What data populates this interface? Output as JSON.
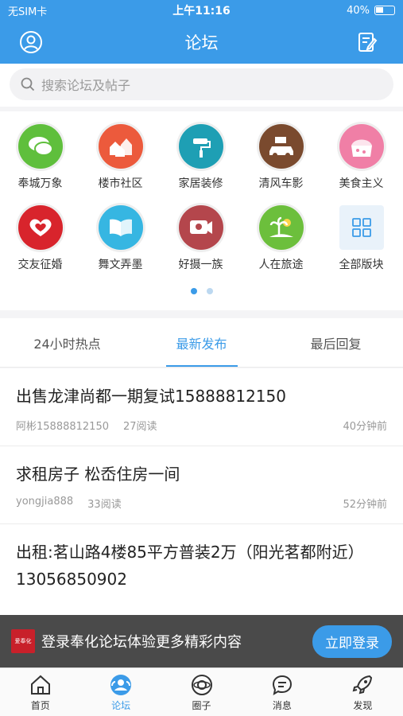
{
  "status": {
    "carrier": "无SIM卡",
    "time": "上午11:16",
    "battery": "40%"
  },
  "header": {
    "title": "论坛"
  },
  "search": {
    "placeholder": "搜索论坛及帖子"
  },
  "categories": [
    {
      "label": "奉城万象",
      "icon": "chat-bubbles-icon",
      "color": "#5fbf3c"
    },
    {
      "label": "楼市社区",
      "icon": "houses-icon",
      "color": "#ec5a3c"
    },
    {
      "label": "家居装修",
      "icon": "paint-roller-icon",
      "color": "#1e9fb4"
    },
    {
      "label": "清风车影",
      "icon": "car-icon",
      "color": "#7a4a2e"
    },
    {
      "label": "美食主义",
      "icon": "cake-icon",
      "color": "#f07fa6"
    },
    {
      "label": "交友征婚",
      "icon": "hearts-icon",
      "color": "#d8242c"
    },
    {
      "label": "舞文弄墨",
      "icon": "book-icon",
      "color": "#36b6e2"
    },
    {
      "label": "好摄一族",
      "icon": "camera-icon",
      "color": "#b4464c"
    },
    {
      "label": "人在旅途",
      "icon": "palm-tree-icon",
      "color": "#6cbf3c"
    },
    {
      "label": "全部版块",
      "icon": "grid-icon",
      "color": "#e9f2fa"
    }
  ],
  "tabs": [
    {
      "label": "24小时热点"
    },
    {
      "label": "最新发布"
    },
    {
      "label": "最后回复"
    }
  ],
  "posts": [
    {
      "title": "出售龙津尚都一期复试15888812150",
      "author": "阿彬15888812150",
      "views": "27阅读",
      "time": "40分钟前"
    },
    {
      "title": "求租房子 松岙住房一间",
      "author": "yongjia888",
      "views": "33阅读",
      "time": "52分钟前"
    },
    {
      "title": "出租:茗山路4楼85平方普装2万（阳光茗都附近）13056850902",
      "author": "",
      "views": "",
      "time": ""
    }
  ],
  "promo": {
    "logo": "爱奉化",
    "text": "登录奉化论坛体验更多精彩内容",
    "button": "立即登录"
  },
  "tabbar": [
    {
      "label": "首页"
    },
    {
      "label": "论坛"
    },
    {
      "label": "圈子"
    },
    {
      "label": "消息"
    },
    {
      "label": "发现"
    }
  ]
}
